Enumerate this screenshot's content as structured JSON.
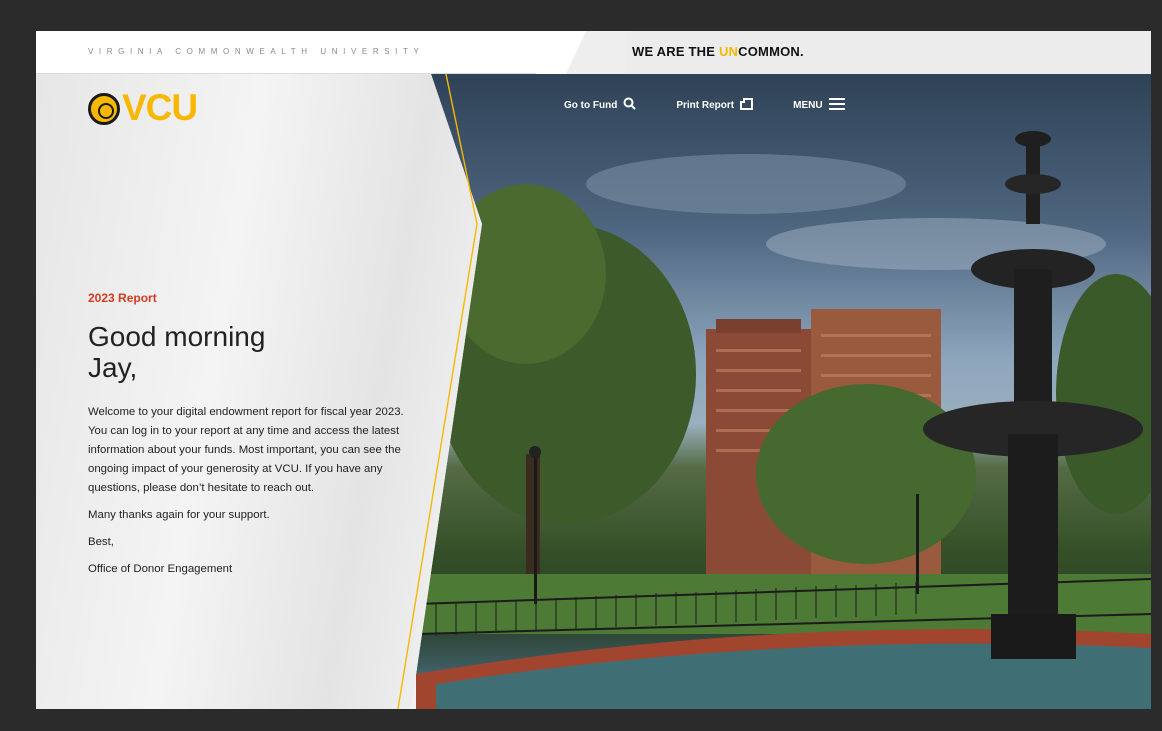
{
  "header": {
    "university": "VIRGINIA COMMONWEALTH UNIVERSITY",
    "tagline_prefix": "WE ARE THE ",
    "tagline_highlight": "UN",
    "tagline_suffix": "COMMON."
  },
  "logo": {
    "text": "VCU"
  },
  "nav": {
    "items": [
      {
        "label": "Go to Fund",
        "icon": "search-icon"
      },
      {
        "label": "Print Report",
        "icon": "print-icon"
      },
      {
        "label": "MENU",
        "icon": "hamburger-icon"
      }
    ]
  },
  "content": {
    "eyebrow": "2023 Report",
    "greeting_line1": "Good morning",
    "greeting_line2": "Jay,",
    "body": "Welcome to your digital endowment report for fiscal year 2023. You can log in to your report at any time and access the latest information about your funds. Most important, you can see the ongoing impact of your generosity at VCU. If you have any questions, please don’t hesitate to reach out.",
    "thanks": "Many thanks again for your support.",
    "signoff": "Best,",
    "signature": "Office of Donor Engagement"
  },
  "colors": {
    "brand_gold": "#f8b800",
    "eyebrow_red": "#d23b1f"
  }
}
